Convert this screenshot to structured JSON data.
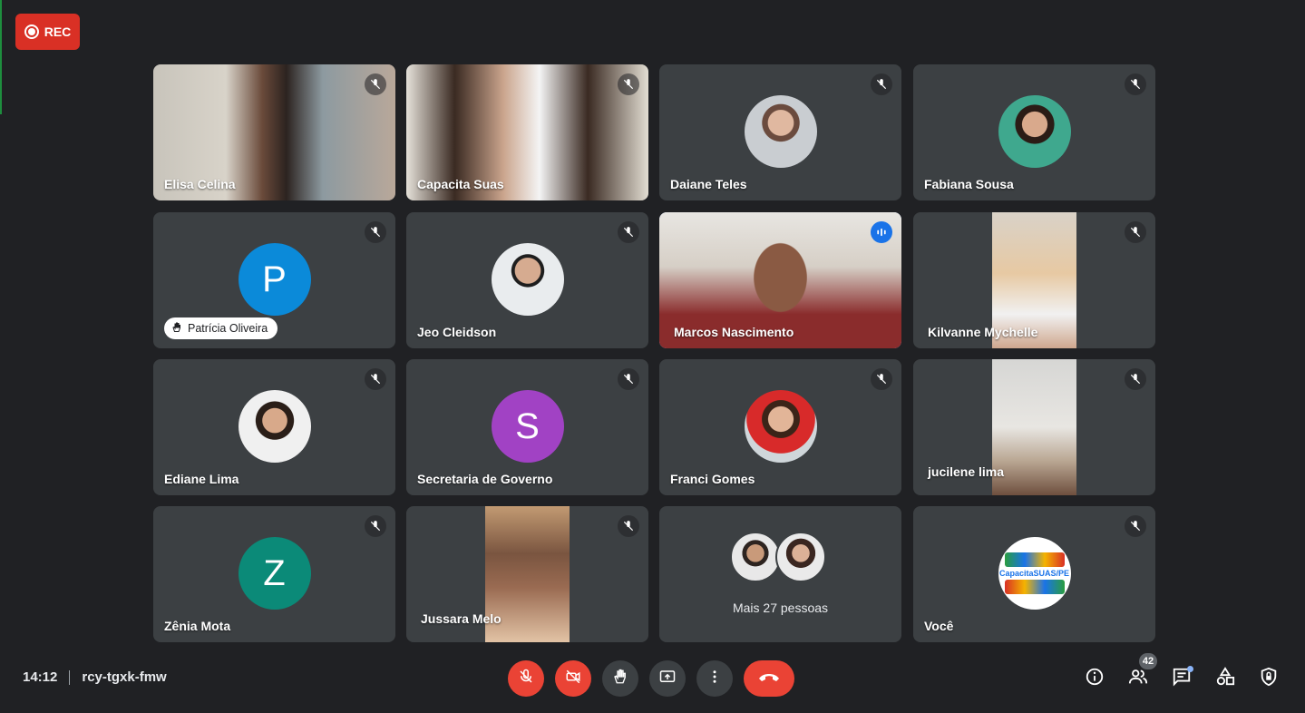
{
  "recording": {
    "label": "REC",
    "color": "#d93025"
  },
  "meeting": {
    "time": "14:12",
    "code": "rcy-tgxk-fmw"
  },
  "participants": [
    {
      "name": "Elisa Celina",
      "kind": "video",
      "muted": true
    },
    {
      "name": "Capacita Suas",
      "kind": "video",
      "muted": true
    },
    {
      "name": "Daiane Teles",
      "kind": "photo",
      "muted": true
    },
    {
      "name": "Fabiana Sousa",
      "kind": "photo",
      "muted": true
    },
    {
      "name": "Patrícia Oliveira",
      "kind": "letter",
      "letter": "P",
      "color": "#0b8ad9",
      "hand_raised": true,
      "muted": true
    },
    {
      "name": "Jeo Cleidson",
      "kind": "photo",
      "muted": true
    },
    {
      "name": "Marcos Nascimento",
      "kind": "video",
      "speaking": true
    },
    {
      "name": "Kilvanne Mychelle",
      "kind": "video",
      "muted": true
    },
    {
      "name": "Ediane Lima",
      "kind": "photo",
      "muted": true
    },
    {
      "name": "Secretaria de Governo",
      "kind": "letter",
      "letter": "S",
      "color": "#a142c4",
      "muted": true
    },
    {
      "name": "Franci Gomes",
      "kind": "photo",
      "muted": true
    },
    {
      "name": "jucilene lima",
      "kind": "video",
      "muted": true
    },
    {
      "name": "Zênia Mota",
      "kind": "letter",
      "letter": "Z",
      "color": "#0b8a78",
      "muted": true
    },
    {
      "name": "Jussara Melo",
      "kind": "video",
      "muted": true
    },
    {
      "name": "Mais 27 pessoas",
      "kind": "overflow"
    },
    {
      "name": "Você",
      "kind": "logo",
      "logo_text": "CapacitaSUAS/PE",
      "muted": true
    }
  ],
  "controls": {
    "mic": "mic-off-icon",
    "camera": "camera-off-icon",
    "hand": "raise-hand-icon",
    "present": "present-screen-icon",
    "more": "more-options-icon",
    "leave": "leave-call-icon"
  },
  "right_panel": {
    "people_count": "42"
  }
}
